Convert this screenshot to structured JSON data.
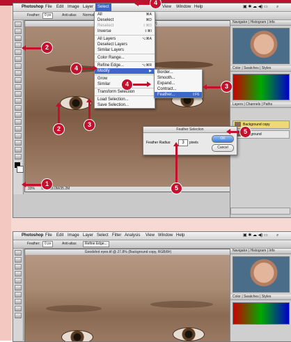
{
  "colors": {
    "accent": "#c3112d",
    "menu_highlight": "#3d67c9",
    "selected_layer": "#f0d778"
  },
  "menubar": {
    "app": "Photoshop",
    "items": [
      "File",
      "Edit",
      "Image",
      "Layer",
      "Select",
      "Filter",
      "Analysis",
      "View",
      "Window",
      "Help"
    ],
    "active": "Select"
  },
  "optionsbar": {
    "feather_label": "Feather:",
    "feather_value": "0 px",
    "antialias": "Anti-alias",
    "style": "Normal",
    "refine_edge": "Refine Edge..."
  },
  "document": {
    "title": "Goodshot eyes.tif @ 33.3% (RGB/8#)",
    "status_zoom": "33%",
    "status_doc": "Doc: 18.0M/35.2M"
  },
  "document2": {
    "title": "Goodshot eyes.tif @ 27.8% (Background copy, RGB/8#)"
  },
  "select_menu": {
    "items": [
      {
        "label": "All",
        "shortcut": "⌘A",
        "dim": false
      },
      {
        "label": "Deselect",
        "shortcut": "⌘D",
        "dim": false
      },
      {
        "label": "Reselect",
        "shortcut": "⇧⌘D",
        "dim": true
      },
      {
        "label": "Inverse",
        "shortcut": "⇧⌘I",
        "dim": false
      },
      {
        "sep": true
      },
      {
        "label": "All Layers",
        "shortcut": "⌥⌘A",
        "dim": false
      },
      {
        "label": "Deselect Layers",
        "shortcut": "",
        "dim": false
      },
      {
        "label": "Similar Layers",
        "shortcut": "",
        "dim": false
      },
      {
        "sep": true
      },
      {
        "label": "Color Range...",
        "shortcut": "",
        "dim": false
      },
      {
        "sep": true
      },
      {
        "label": "Refine Edge...",
        "shortcut": "⌥⌘R",
        "dim": false
      },
      {
        "label": "Modify",
        "shortcut": "▶",
        "dim": false,
        "highlight": true
      },
      {
        "sep": true
      },
      {
        "label": "Grow",
        "shortcut": "",
        "dim": false
      },
      {
        "label": "Similar",
        "shortcut": "",
        "dim": false
      },
      {
        "sep": true
      },
      {
        "label": "Transform Selection",
        "shortcut": "",
        "dim": false
      },
      {
        "sep": true
      },
      {
        "label": "Load Selection...",
        "shortcut": "",
        "dim": false
      },
      {
        "label": "Save Selection...",
        "shortcut": "",
        "dim": false
      }
    ]
  },
  "modify_menu": {
    "items": [
      {
        "label": "Border...",
        "shortcut": ""
      },
      {
        "label": "Smooth...",
        "shortcut": ""
      },
      {
        "label": "Expand...",
        "shortcut": ""
      },
      {
        "label": "Contract...",
        "shortcut": ""
      },
      {
        "label": "Feather...",
        "shortcut": "⇧F6",
        "highlight": true
      }
    ]
  },
  "feather_dialog": {
    "title": "Feather Selection",
    "label": "Feather Radius:",
    "value": "3",
    "unit": "pixels",
    "ok": "OK",
    "cancel": "Cancel"
  },
  "panels": {
    "navigator_tabs": "Navigator | Histogram | Info",
    "color_tabs": "Color | Swatches | Styles",
    "layers_tabs": "Layers | Channels | Paths",
    "layers": [
      {
        "name": "Background copy",
        "selected": true
      },
      {
        "name": "Background",
        "selected": false
      }
    ]
  },
  "callouts": {
    "c1": "1",
    "c2a": "2",
    "c2b": "2",
    "c3a": "3",
    "c3b": "3",
    "c4a": "4",
    "c4b": "4",
    "c4c": "4",
    "c5a": "5",
    "c5b": "5"
  }
}
